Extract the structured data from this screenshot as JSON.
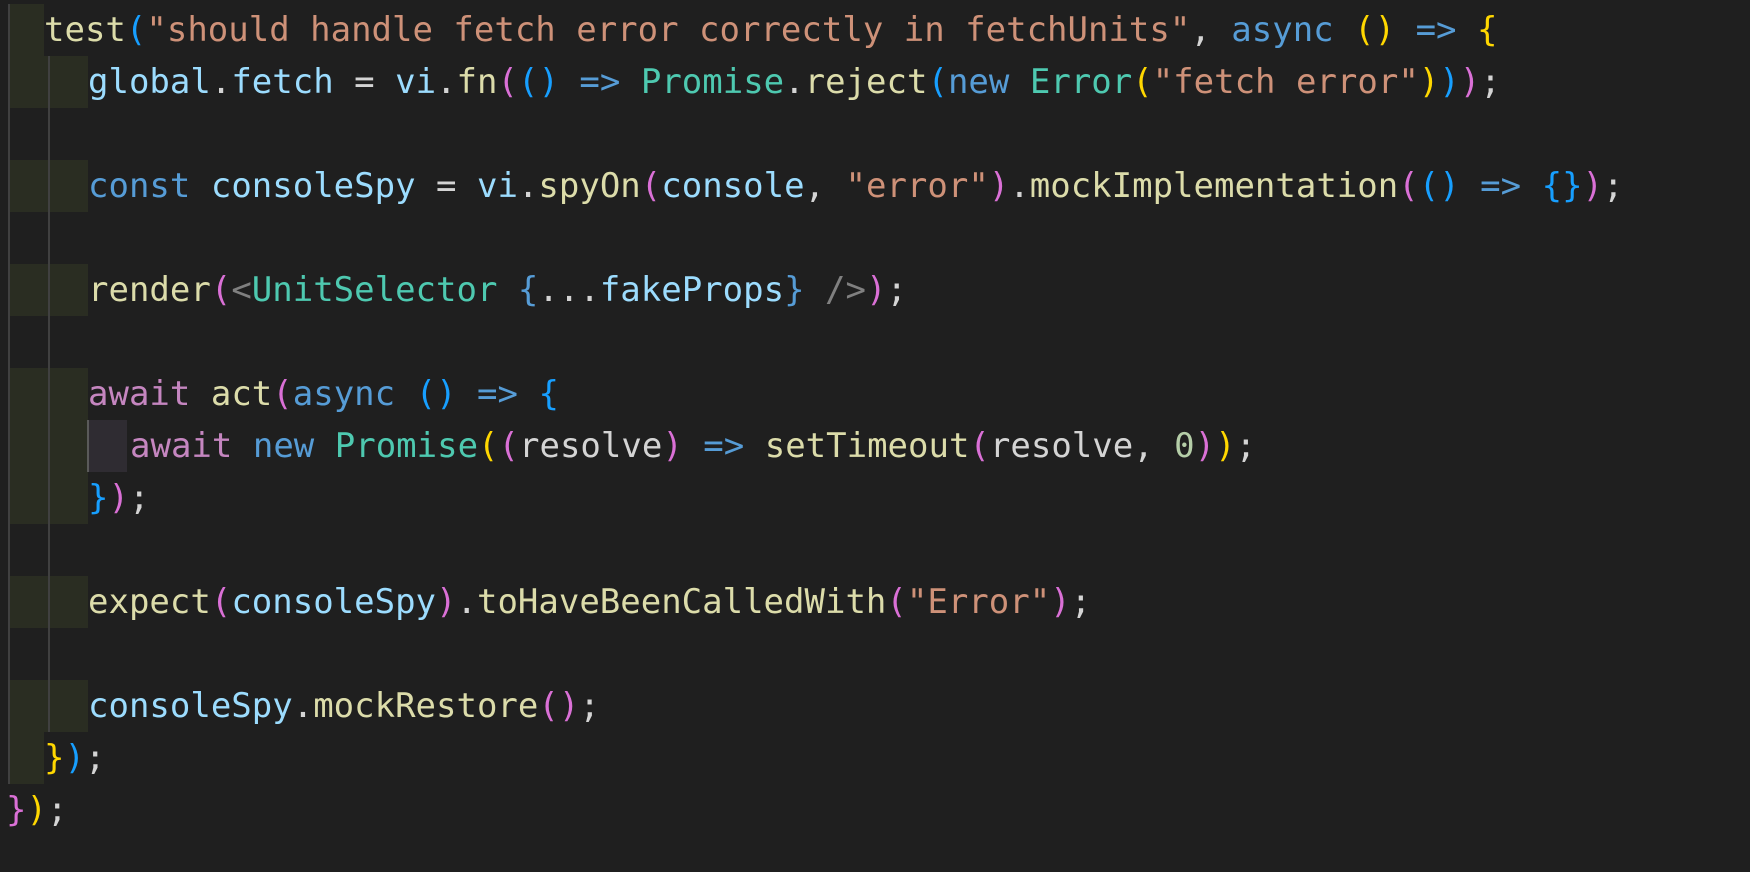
{
  "editor": {
    "language": "TypeScript React",
    "lines": [
      {
        "tokens": [
          [
            "fn",
            "test"
          ],
          [
            "br3",
            "("
          ],
          [
            "str",
            "\"should handle fetch error correctly in fetchUnits\""
          ],
          [
            "txt",
            ", "
          ],
          [
            "kw",
            "async"
          ],
          [
            "txt",
            " "
          ],
          [
            "br1",
            "()"
          ],
          [
            "txt",
            " "
          ],
          [
            "kw",
            "=>"
          ],
          [
            "txt",
            " "
          ],
          [
            "br1",
            "{"
          ]
        ]
      },
      {
        "tokens": [
          [
            "var",
            "global"
          ],
          [
            "txt",
            "."
          ],
          [
            "var",
            "fetch"
          ],
          [
            "txt",
            " = "
          ],
          [
            "var",
            "vi"
          ],
          [
            "txt",
            "."
          ],
          [
            "fn",
            "fn"
          ],
          [
            "br2",
            "("
          ],
          [
            "br3",
            "()"
          ],
          [
            "txt",
            " "
          ],
          [
            "kw",
            "=>"
          ],
          [
            "txt",
            " "
          ],
          [
            "cls",
            "Promise"
          ],
          [
            "txt",
            "."
          ],
          [
            "fn",
            "reject"
          ],
          [
            "br3",
            "("
          ],
          [
            "kw",
            "new"
          ],
          [
            "txt",
            " "
          ],
          [
            "cls",
            "Error"
          ],
          [
            "br1",
            "("
          ],
          [
            "str",
            "\"fetch error\""
          ],
          [
            "br1",
            ")"
          ],
          [
            "br3",
            ")"
          ],
          [
            "br2",
            ")"
          ],
          [
            "txt",
            ";"
          ]
        ]
      },
      {
        "tokens": []
      },
      {
        "tokens": [
          [
            "kw",
            "const"
          ],
          [
            "txt",
            " "
          ],
          [
            "var",
            "consoleSpy"
          ],
          [
            "txt",
            " = "
          ],
          [
            "var",
            "vi"
          ],
          [
            "txt",
            "."
          ],
          [
            "fn",
            "spyOn"
          ],
          [
            "br2",
            "("
          ],
          [
            "var",
            "console"
          ],
          [
            "txt",
            ", "
          ],
          [
            "str",
            "\"error\""
          ],
          [
            "br2",
            ")"
          ],
          [
            "txt",
            "."
          ],
          [
            "fn",
            "mockImplementation"
          ],
          [
            "br2",
            "("
          ],
          [
            "br3",
            "()"
          ],
          [
            "txt",
            " "
          ],
          [
            "kw",
            "=>"
          ],
          [
            "txt",
            " "
          ],
          [
            "br3",
            "{}"
          ],
          [
            "br2",
            ")"
          ],
          [
            "txt",
            ";"
          ]
        ]
      },
      {
        "tokens": []
      },
      {
        "tokens": [
          [
            "fn",
            "render"
          ],
          [
            "br2",
            "("
          ],
          [
            "tag",
            "<"
          ],
          [
            "cls",
            "UnitSelector"
          ],
          [
            "txt",
            " "
          ],
          [
            "kw",
            "{"
          ],
          [
            "txt",
            "..."
          ],
          [
            "var",
            "fakeProps"
          ],
          [
            "kw",
            "}"
          ],
          [
            "txt",
            " "
          ],
          [
            "tag",
            "/>"
          ],
          [
            "br2",
            ")"
          ],
          [
            "txt",
            ";"
          ]
        ]
      },
      {
        "tokens": []
      },
      {
        "tokens": [
          [
            "ctl",
            "await"
          ],
          [
            "txt",
            " "
          ],
          [
            "fn",
            "act"
          ],
          [
            "br2",
            "("
          ],
          [
            "kw",
            "async"
          ],
          [
            "txt",
            " "
          ],
          [
            "br3",
            "()"
          ],
          [
            "txt",
            " "
          ],
          [
            "kw",
            "=>"
          ],
          [
            "txt",
            " "
          ],
          [
            "br3",
            "{"
          ]
        ]
      },
      {
        "tokens": [
          [
            "ctl",
            "await"
          ],
          [
            "txt",
            " "
          ],
          [
            "kw",
            "new"
          ],
          [
            "txt",
            " "
          ],
          [
            "cls",
            "Promise"
          ],
          [
            "br1",
            "("
          ],
          [
            "br2",
            "("
          ],
          [
            "txt",
            "resolve"
          ],
          [
            "br2",
            ")"
          ],
          [
            "txt",
            " "
          ],
          [
            "kw",
            "=>"
          ],
          [
            "txt",
            " "
          ],
          [
            "fn",
            "setTimeout"
          ],
          [
            "br2",
            "("
          ],
          [
            "txt",
            "resolve, "
          ],
          [
            "num",
            "0"
          ],
          [
            "br2",
            ")"
          ],
          [
            "br1",
            ")"
          ],
          [
            "txt",
            ";"
          ]
        ]
      },
      {
        "tokens": [
          [
            "br3",
            "}"
          ],
          [
            "br2",
            ")"
          ],
          [
            "txt",
            ";"
          ]
        ]
      },
      {
        "tokens": []
      },
      {
        "tokens": [
          [
            "fn",
            "expect"
          ],
          [
            "br2",
            "("
          ],
          [
            "var",
            "consoleSpy"
          ],
          [
            "br2",
            ")"
          ],
          [
            "txt",
            "."
          ],
          [
            "fn",
            "toHaveBeenCalledWith"
          ],
          [
            "br2",
            "("
          ],
          [
            "str",
            "\"Error\""
          ],
          [
            "br2",
            ")"
          ],
          [
            "txt",
            ";"
          ]
        ]
      },
      {
        "tokens": []
      },
      {
        "tokens": [
          [
            "var",
            "consoleSpy"
          ],
          [
            "txt",
            "."
          ],
          [
            "fn",
            "mockRestore"
          ],
          [
            "br2",
            "()"
          ],
          [
            "txt",
            ";"
          ]
        ]
      },
      {
        "tokens": [
          [
            "br1",
            "}"
          ],
          [
            "br3",
            ")"
          ],
          [
            "txt",
            ";"
          ]
        ]
      },
      {
        "tokens": [
          [
            "br2",
            "}"
          ],
          [
            "br1",
            ")"
          ],
          [
            "txt",
            ";"
          ]
        ]
      }
    ]
  }
}
